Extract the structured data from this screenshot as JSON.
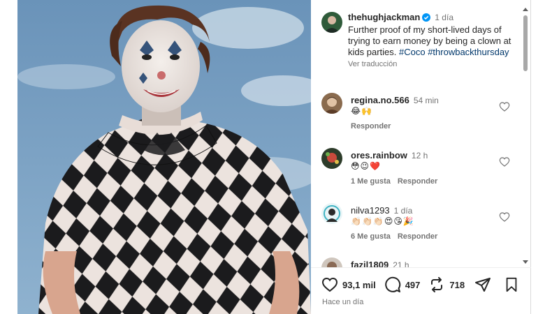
{
  "post": {
    "username": "thehughjackman",
    "time": "1 día",
    "caption_text": "Further proof of my short-lived days of trying to earn money by being a clown at kids parties.",
    "hashtags": [
      "#Coco",
      "#throwbackthursday"
    ],
    "translate_label": "Ver traducción"
  },
  "comments": [
    {
      "username": "regina.no.566",
      "time": "54 min",
      "emojis": "😂🙌",
      "likes_label": "",
      "reply_label": "Responder"
    },
    {
      "username": "ores.rainbow",
      "time": "12 h",
      "emojis": "😳😉❤️",
      "likes_label": "1 Me gusta",
      "reply_label": "Responder"
    },
    {
      "username": "nilva1293",
      "time": "1 día",
      "emojis": "👏🏻👏🏻👏🏻😍😘🎉",
      "likes_label": "6 Me gusta",
      "reply_label": "Responder"
    },
    {
      "username": "fazil1809",
      "time": "21 h",
      "emojis": "",
      "likes_label": "",
      "reply_label": ""
    }
  ],
  "stats": {
    "likes": "93,1 mil",
    "comments": "497",
    "reposts": "718"
  },
  "post_date": "Hace un día",
  "icons": {
    "like": "heart-icon",
    "comment": "comment-icon",
    "repost": "repost-icon",
    "share": "share-icon",
    "save": "bookmark-icon",
    "verified": "verified-badge-icon"
  },
  "colors": {
    "verified": "#0095f6",
    "hashtag": "#00376b",
    "muted_text": "#737373",
    "sky": "#5f88ae"
  }
}
